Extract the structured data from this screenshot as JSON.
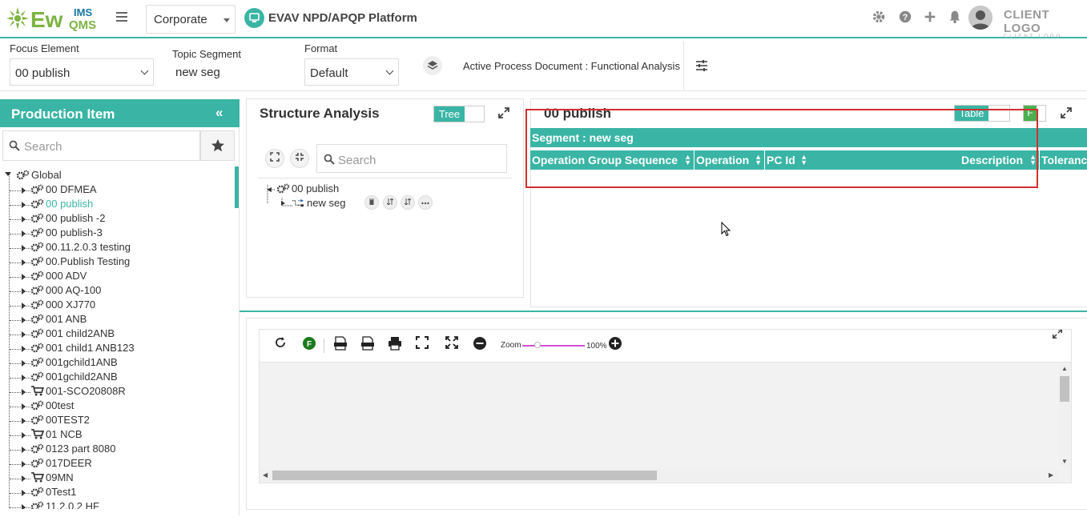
{
  "app": {
    "logo_text": "EWQMS",
    "logo_sup": "IMS",
    "corporate_select": "Corporate",
    "platform_title": "EVAV NPD/APQP Platform",
    "client_logo": "CLIENT LOGO",
    "client_logo_sub": "CLIENT LOGO"
  },
  "filters": {
    "focus_label": "Focus Element",
    "focus_value": "00 publish",
    "topic_label": "Topic Segment",
    "topic_value": "new seg",
    "format_label": "Format",
    "format_value": "Default",
    "active_doc": "Active Process Document : Functional Analysis"
  },
  "left_panel": {
    "title": "Production Item",
    "search_placeholder": "Search",
    "root": "Global",
    "items": [
      {
        "label": "00 DFMEA",
        "icon": "gear"
      },
      {
        "label": "00 publish",
        "icon": "gear"
      },
      {
        "label": "00 publish -2",
        "icon": "gear"
      },
      {
        "label": "00 publish-3",
        "icon": "gear"
      },
      {
        "label": "00.11.2.0.3 testing",
        "icon": "gear"
      },
      {
        "label": "00.Publish Testing",
        "icon": "gear"
      },
      {
        "label": "000 ADV",
        "icon": "gear"
      },
      {
        "label": "000 AQ-100",
        "icon": "gear"
      },
      {
        "label": "000 XJ770",
        "icon": "gear"
      },
      {
        "label": "001 ANB",
        "icon": "gear"
      },
      {
        "label": "001 child2ANB",
        "icon": "gear"
      },
      {
        "label": "001 child1 ANB123",
        "icon": "gear"
      },
      {
        "label": "001gchild1ANB",
        "icon": "gear"
      },
      {
        "label": "001gchild2ANB",
        "icon": "gear"
      },
      {
        "label": "001-SCO20808R",
        "icon": "cart"
      },
      {
        "label": "00test",
        "icon": "gear"
      },
      {
        "label": "00TEST2",
        "icon": "gear"
      },
      {
        "label": "01 NCB",
        "icon": "cart"
      },
      {
        "label": "0123 part 8080",
        "icon": "gear"
      },
      {
        "label": "017DEER",
        "icon": "gear"
      },
      {
        "label": "09MN",
        "icon": "cart"
      },
      {
        "label": "0Test1",
        "icon": "gear"
      },
      {
        "label": "11.2.0.2 HF",
        "icon": "gear"
      }
    ]
  },
  "structure": {
    "title": "Structure Analysis",
    "toggle_label": "Tree",
    "search_placeholder": "Search",
    "root_node": "00 publish",
    "child_node": "new seg"
  },
  "detail": {
    "title": "00 publish",
    "toggle_label": "Table",
    "f_label": "F",
    "segment_label": "Segment : new seg",
    "columns": [
      "Operation Group Sequence",
      "Operation",
      "PC Id",
      "Description",
      "Toleranc"
    ]
  },
  "bottom": {
    "zoom_label": "Zoom",
    "zoom_value": "100%",
    "f_label": "F"
  }
}
